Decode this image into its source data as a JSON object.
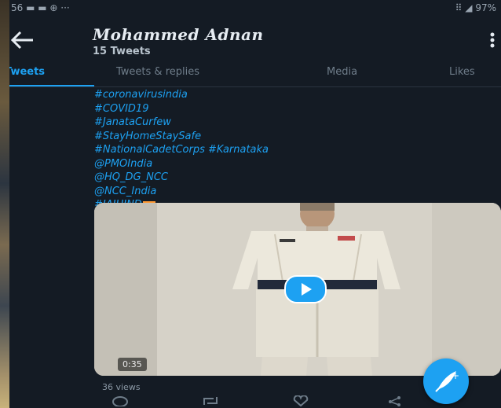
{
  "status_bar": {
    "left": "56 ▬ ▬ ⊕ ···",
    "right": "⠿ ◢ 97%"
  },
  "profile": {
    "name": "Mohammed Adnan",
    "tweet_count": "15 Tweets"
  },
  "tabs": [
    {
      "label": "Tweets",
      "active": true
    },
    {
      "label": "Tweets & replies",
      "active": false
    },
    {
      "label": "Media",
      "active": false
    },
    {
      "label": "Likes",
      "active": false
    }
  ],
  "tweet": {
    "lines": [
      "#coronavirusindia",
      "#COVID19",
      "#JanataCurfew",
      "#StayHomeStaySafe",
      "#NationalCadetCorps #Karnataka",
      "@PMOIndia",
      "@HQ_DG_NCC",
      "@NCC_India",
      "#JAIHIND"
    ],
    "video_duration": "0:35",
    "views": "36 views"
  },
  "icons": {
    "back": "arrow-left-icon",
    "more": "more-vertical-icon",
    "play": "play-icon",
    "reply": "reply-icon",
    "retweet": "retweet-icon",
    "like": "heart-icon",
    "share": "share-icon",
    "compose": "compose-feather-icon"
  },
  "colors": {
    "accent": "#1da1f2",
    "background": "#141b24",
    "text_primary": "#e6ecf2",
    "text_muted": "#6f7d8a"
  }
}
